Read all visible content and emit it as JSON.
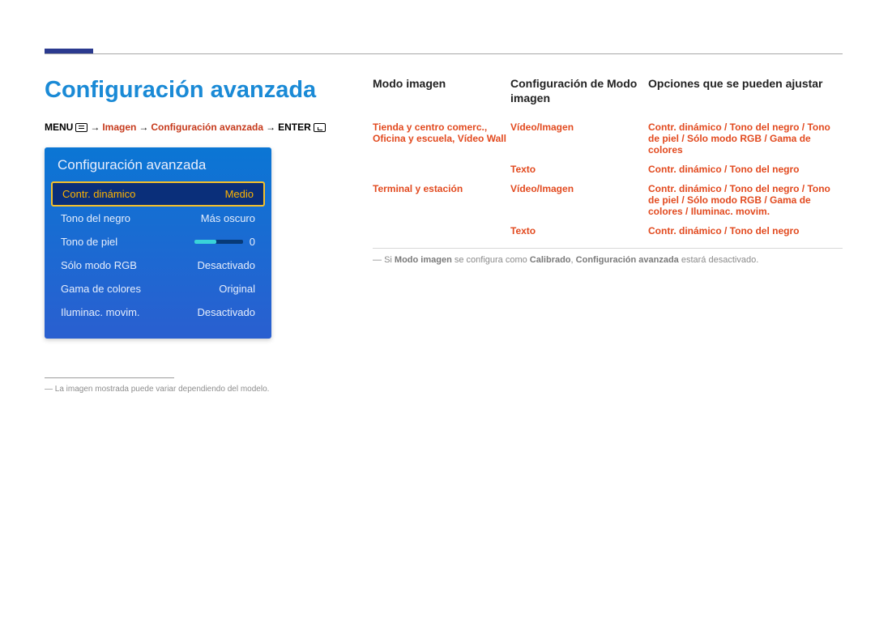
{
  "page_title": "Configuración avanzada",
  "breadcrumb": {
    "menu_label": "MENU",
    "arrow": "→",
    "path1": "Imagen",
    "path2": "Configuración avanzada",
    "enter_label": "ENTER"
  },
  "panel": {
    "title": "Configuración avanzada",
    "rows": [
      {
        "label": "Contr. dinámico",
        "value": "Medio",
        "selected": true
      },
      {
        "label": "Tono del negro",
        "value": "Más oscuro"
      },
      {
        "label": "Tono de piel",
        "value": "0",
        "slider": true
      },
      {
        "label": "Sólo modo RGB",
        "value": "Desactivado"
      },
      {
        "label": "Gama de colores",
        "value": "Original"
      },
      {
        "label": "Iluminac. movim.",
        "value": "Desactivado"
      }
    ]
  },
  "footnote_text": "La imagen mostrada puede variar dependiendo del modelo.",
  "table": {
    "headers": {
      "col1": "Modo imagen",
      "col2": "Configuración de Modo imagen",
      "col3": "Opciones que se pueden ajustar"
    },
    "rows": [
      {
        "col1": "Tienda y centro comerc., Oficina y escuela, Vídeo Wall",
        "col2": "Vídeo/Imagen",
        "col3": "Contr. dinámico / Tono del negro / Tono de piel / Sólo modo RGB / Gama de colores"
      },
      {
        "col1": "",
        "col2": "Texto",
        "col3": "Contr. dinámico / Tono del negro"
      },
      {
        "col1": "Terminal y estación",
        "col2": "Vídeo/Imagen",
        "col3": "Contr. dinámico / Tono del negro / Tono de piel / Sólo modo RGB / Gama de colores / Iluminac. movim."
      },
      {
        "col1": "",
        "col2": "Texto",
        "col3": "Contr. dinámico / Tono del negro"
      }
    ]
  },
  "note": {
    "pre": "Si ",
    "b1": "Modo imagen",
    "mid1": " se configura como ",
    "b2": "Calibrado",
    "mid2": ", ",
    "b3": "Configuración avanzada",
    "post": " estará desactivado."
  }
}
